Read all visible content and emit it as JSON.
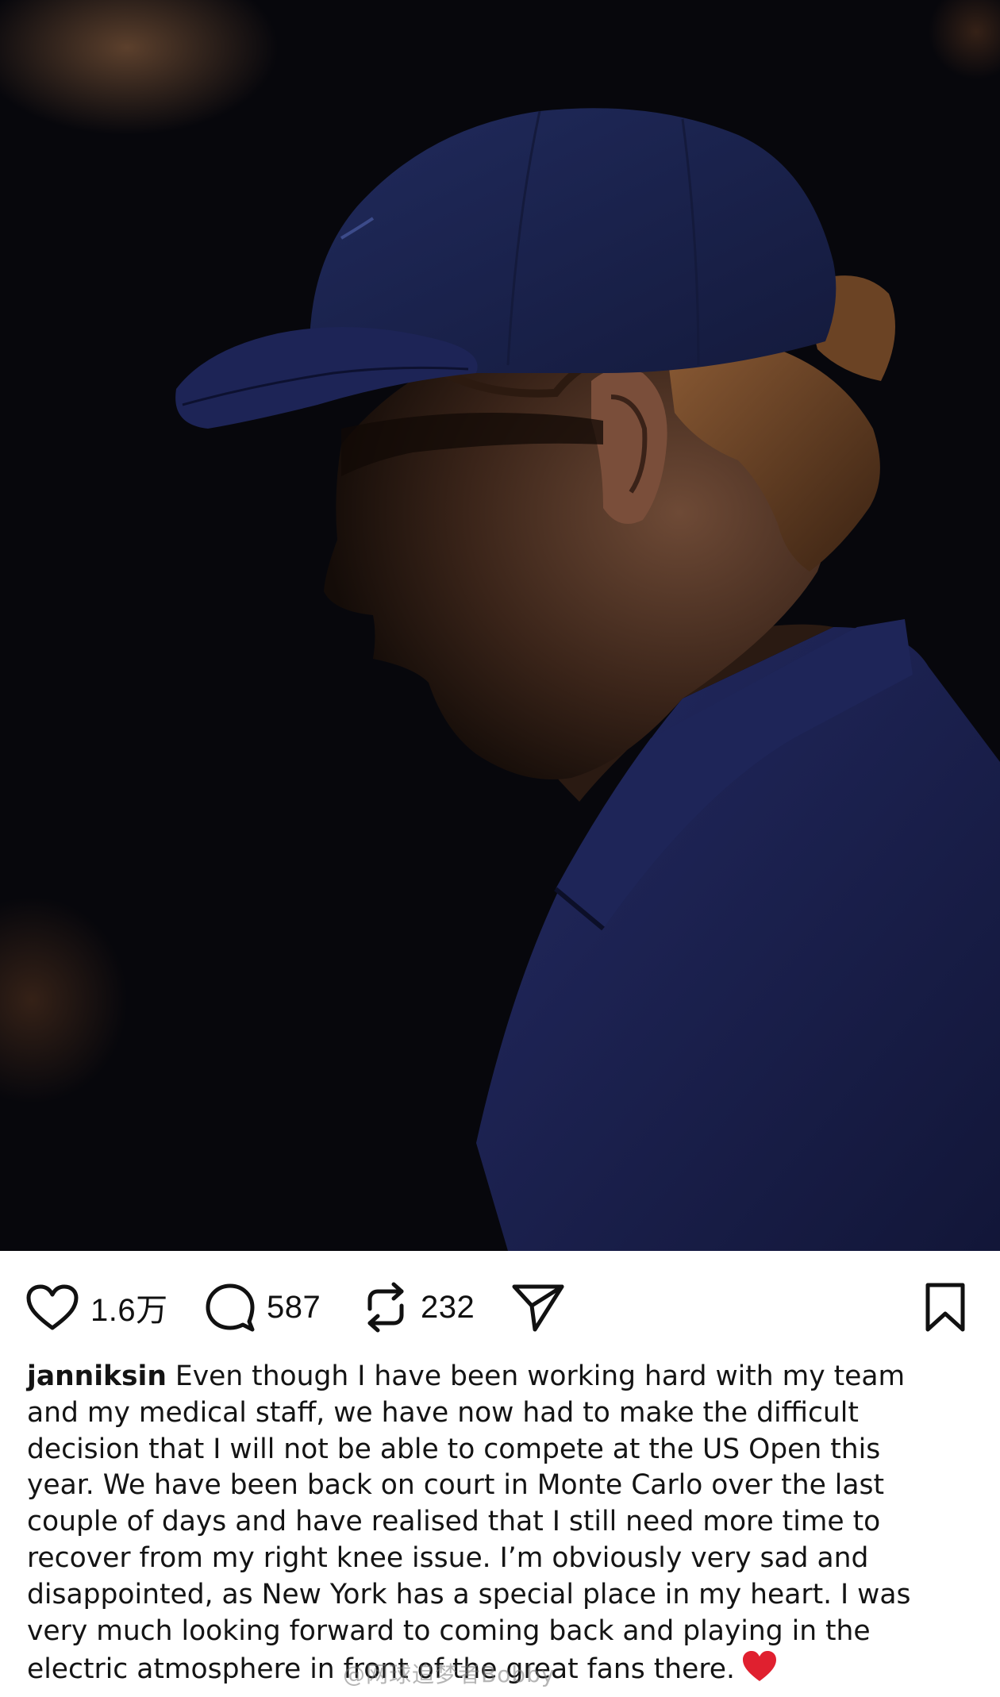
{
  "post": {
    "photo_alt": "tennis player in navy cap and polo, head bowed, dark background",
    "likes": "1.6万",
    "comments": "587",
    "reposts": "232",
    "username": "janniksin",
    "caption_lines": [
      "Even though I have been working hard with my team",
      "and my medical staff, we have now had to make the difficult",
      "decision that I will not be able to compete at the US Open this",
      "year. We have been back on court in Monte Carlo over the last",
      "couple of days and have realised that I still need more time to",
      "recover from my right knee issue. I’m obviously very sad and",
      "disappointed, as New York has a special place in my heart. I was",
      "very much looking forward to coming back and playing in the",
      "electric atmosphere in front of the great fans there."
    ],
    "emoji": "red-heart",
    "watermark": "@网球追梦者Bobby"
  },
  "icons": {
    "like": "heart-outline-icon",
    "comment": "speech-bubble-icon",
    "repost": "repost-arrows-icon",
    "share": "paper-plane-icon",
    "save": "bookmark-icon"
  },
  "colors": {
    "photo_background": "#07070c",
    "cap_navy": "#1c2350",
    "shirt_navy": "#1a1f4e",
    "text": "#141414",
    "heart_red": "#e0202f"
  }
}
